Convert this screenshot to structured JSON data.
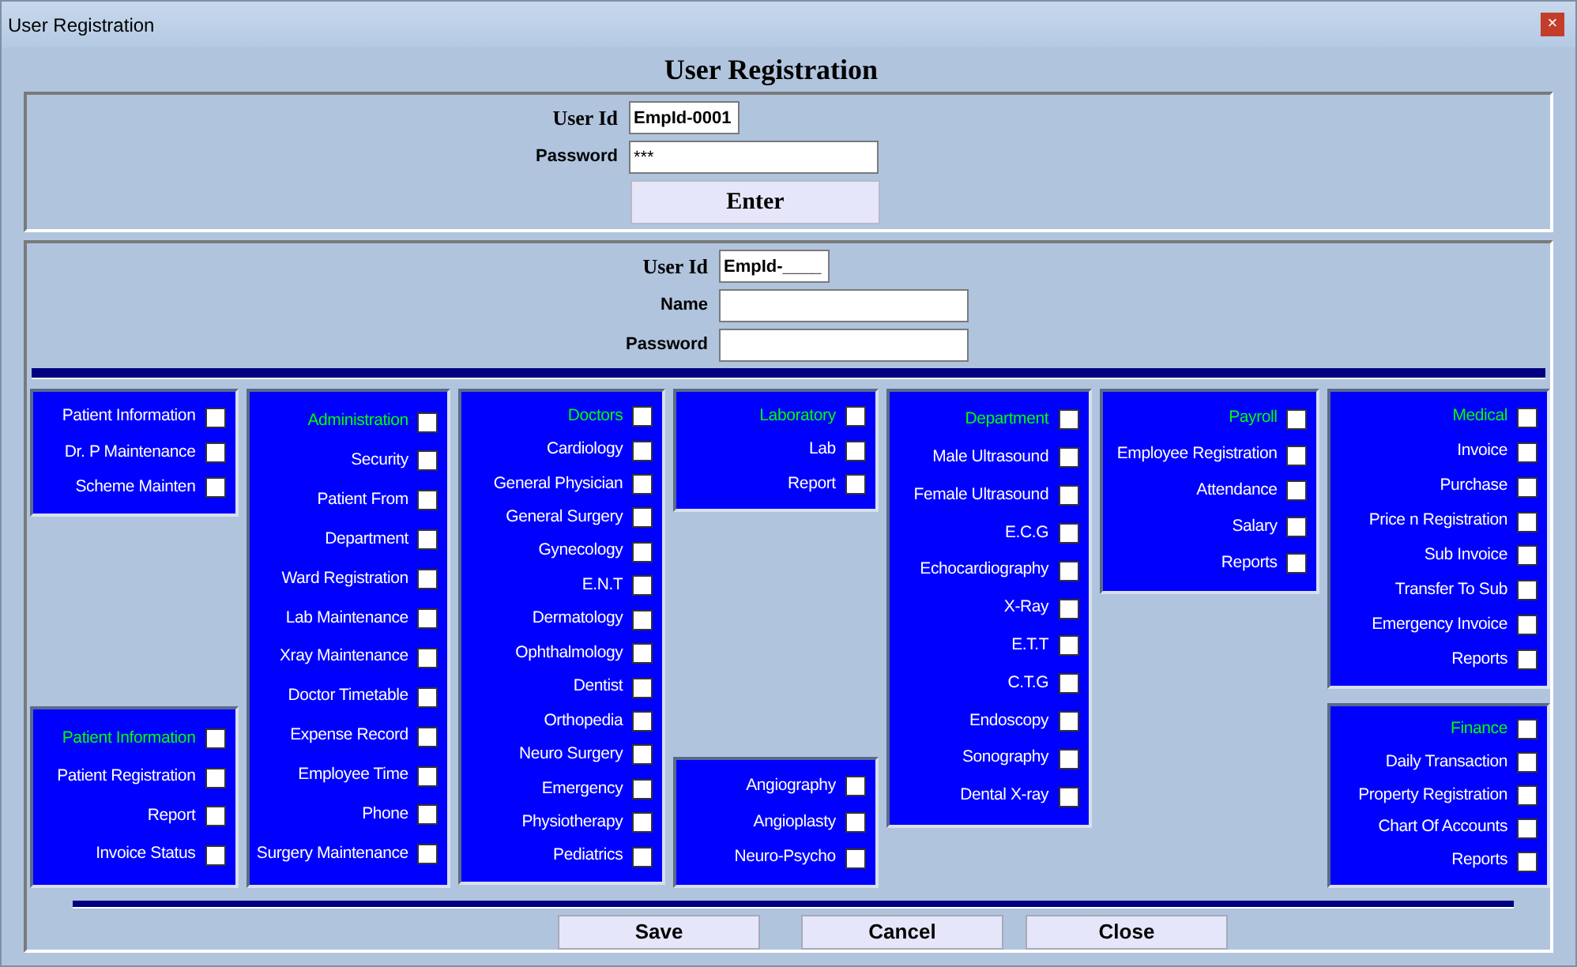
{
  "window": {
    "title": "User Registration",
    "close_glyph": "×"
  },
  "heading": "User Registration",
  "login": {
    "fields": [
      {
        "label": "User Id",
        "value": "EmpId-0001",
        "kind": "short"
      },
      {
        "label": "Password",
        "value": "***",
        "kind": "long"
      }
    ],
    "enter_button": "Enter"
  },
  "new_user": {
    "fields": [
      {
        "label": "User Id",
        "value": "EmpId-____",
        "kind": "short"
      },
      {
        "label": "Name",
        "kind": "long"
      },
      {
        "label": "Password",
        "kind": "long"
      }
    ]
  },
  "permission_columns": [
    {
      "panels": [
        {
          "items": [
            {
              "label": "Patient Information",
              "kind": "option",
              "checked": false
            },
            {
              "label": "Dr. P Maintenance",
              "kind": "option",
              "checked": false
            },
            {
              "label": "Scheme Mainten",
              "kind": "option",
              "checked": false
            }
          ]
        },
        {
          "items": [
            {
              "label": "Patient Information",
              "kind": "heading",
              "checked": false
            },
            {
              "label": "Patient Registration",
              "kind": "option",
              "checked": false
            },
            {
              "label": "Report",
              "kind": "option",
              "checked": false
            },
            {
              "label": "Invoice Status",
              "kind": "option",
              "checked": false
            }
          ]
        }
      ]
    },
    {
      "panels": [
        {
          "items": [
            {
              "label": "Administration",
              "kind": "heading",
              "checked": false
            },
            {
              "label": "Security",
              "kind": "option",
              "checked": false
            },
            {
              "label": "Patient From",
              "kind": "option",
              "checked": false
            },
            {
              "label": "Department",
              "kind": "option",
              "checked": false
            },
            {
              "label": "Ward Registration",
              "kind": "option",
              "checked": false
            },
            {
              "label": "Lab Maintenance",
              "kind": "option",
              "checked": false
            },
            {
              "label": "Xray Maintenance",
              "kind": "option",
              "checked": false
            },
            {
              "label": "Doctor Timetable",
              "kind": "option",
              "checked": false
            },
            {
              "label": "Expense Record",
              "kind": "option",
              "checked": false
            },
            {
              "label": "Employee Time",
              "kind": "option",
              "checked": false
            },
            {
              "label": "Phone",
              "kind": "option",
              "checked": false
            },
            {
              "label": "Surgery Maintenance",
              "kind": "option",
              "checked": false
            }
          ]
        }
      ]
    },
    {
      "panels": [
        {
          "items": [
            {
              "label": "Doctors",
              "kind": "heading",
              "checked": false
            },
            {
              "label": "Cardiology",
              "kind": "option",
              "checked": false
            },
            {
              "label": "General Physician",
              "kind": "option",
              "checked": false
            },
            {
              "label": "General Surgery",
              "kind": "option",
              "checked": false
            },
            {
              "label": "Gynecology",
              "kind": "option",
              "checked": false
            },
            {
              "label": "E.N.T",
              "kind": "option",
              "checked": false
            },
            {
              "label": "Dermatology",
              "kind": "option",
              "checked": false
            },
            {
              "label": "Ophthalmology",
              "kind": "option",
              "checked": false
            },
            {
              "label": "Dentist",
              "kind": "option",
              "checked": false
            },
            {
              "label": "Orthopedia",
              "kind": "option",
              "checked": false
            },
            {
              "label": "Neuro Surgery",
              "kind": "option",
              "checked": false
            },
            {
              "label": "Emergency",
              "kind": "option",
              "checked": false
            },
            {
              "label": "Physiotherapy",
              "kind": "option",
              "checked": false
            },
            {
              "label": "Pediatrics",
              "kind": "option",
              "checked": false
            }
          ]
        }
      ]
    },
    {
      "panels": [
        {
          "items": [
            {
              "label": "Laboratory",
              "kind": "heading",
              "checked": false
            },
            {
              "label": "Lab",
              "kind": "option",
              "checked": false
            },
            {
              "label": "Report",
              "kind": "option",
              "checked": false
            }
          ]
        },
        {
          "items": [
            {
              "label": "Angiography",
              "kind": "option",
              "checked": false
            },
            {
              "label": "Angioplasty",
              "kind": "option",
              "checked": false
            },
            {
              "label": "Neuro-Psycho",
              "kind": "option",
              "checked": false
            }
          ]
        }
      ]
    },
    {
      "panels": [
        {
          "items": [
            {
              "label": "Department",
              "kind": "heading",
              "checked": false
            },
            {
              "label": "Male Ultrasound",
              "kind": "option",
              "checked": false
            },
            {
              "label": "Female Ultrasound",
              "kind": "option",
              "checked": false
            },
            {
              "label": "E.C.G",
              "kind": "option",
              "checked": false
            },
            {
              "label": "Echocardiography",
              "kind": "option",
              "checked": false
            },
            {
              "label": "X-Ray",
              "kind": "option",
              "checked": false
            },
            {
              "label": "E.T.T",
              "kind": "option",
              "checked": false
            },
            {
              "label": "C.T.G",
              "kind": "option",
              "checked": false
            },
            {
              "label": "Endoscopy",
              "kind": "option",
              "checked": false
            },
            {
              "label": "Sonography",
              "kind": "option",
              "checked": false
            },
            {
              "label": "Dental X-ray",
              "kind": "option",
              "checked": false
            }
          ]
        }
      ]
    },
    {
      "panels": [
        {
          "items": [
            {
              "label": "Payroll",
              "kind": "heading",
              "checked": false
            },
            {
              "label": "Employee Registration",
              "kind": "option",
              "checked": false
            },
            {
              "label": "Attendance",
              "kind": "option",
              "checked": false
            },
            {
              "label": "Salary",
              "kind": "option",
              "checked": false
            },
            {
              "label": "Reports",
              "kind": "option",
              "checked": false
            }
          ]
        }
      ]
    },
    {
      "panels": [
        {
          "items": [
            {
              "label": "Medical",
              "kind": "heading",
              "checked": false
            },
            {
              "label": "Invoice",
              "kind": "option",
              "checked": false
            },
            {
              "label": "Purchase",
              "kind": "option",
              "checked": false
            },
            {
              "label": "Price n Registration",
              "kind": "option",
              "checked": false
            },
            {
              "label": "Sub Invoice",
              "kind": "option",
              "checked": false
            },
            {
              "label": "Transfer To Sub",
              "kind": "option",
              "checked": false
            },
            {
              "label": "Emergency Invoice",
              "kind": "option",
              "checked": false
            },
            {
              "label": "Reports",
              "kind": "option",
              "checked": false
            }
          ]
        },
        {
          "items": [
            {
              "label": "Finance",
              "kind": "heading",
              "checked": false
            },
            {
              "label": "Daily Transaction",
              "kind": "option",
              "checked": false
            },
            {
              "label": "Property Registration",
              "kind": "option",
              "checked": false
            },
            {
              "label": "Chart Of Accounts",
              "kind": "option",
              "checked": false
            },
            {
              "label": "Reports",
              "kind": "option",
              "checked": false
            }
          ]
        }
      ]
    }
  ],
  "buttons": [
    "Save",
    "Cancel",
    "Close"
  ]
}
